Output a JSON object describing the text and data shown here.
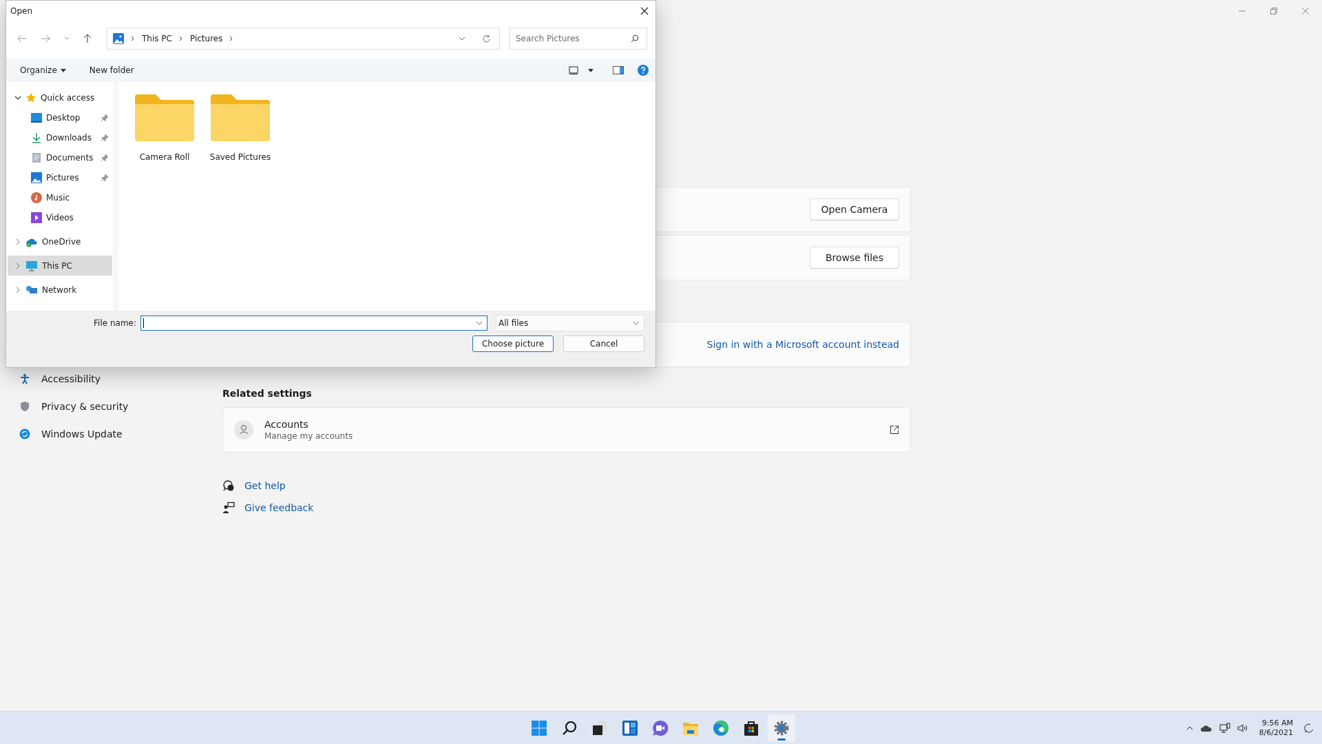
{
  "settings": {
    "sidebar": [
      {
        "label": "Accessibility",
        "kind": "accessibility"
      },
      {
        "label": "Privacy & security",
        "kind": "privacy"
      },
      {
        "label": "Windows Update",
        "kind": "update"
      }
    ],
    "cards": [
      {
        "kind": "button",
        "label": "Open Camera"
      },
      {
        "kind": "button",
        "label": "Browse files"
      },
      {
        "kind": "link",
        "label": "Sign in with a Microsoft account instead"
      }
    ],
    "related_heading": "Related settings",
    "related": [
      {
        "title": "Accounts",
        "subtitle": "Manage my accounts"
      }
    ],
    "help_links": [
      {
        "kind": "help",
        "label": "Get help"
      },
      {
        "kind": "feedback",
        "label": "Give feedback"
      }
    ]
  },
  "dialog": {
    "title": "Open",
    "breadcrumb": [
      "This PC",
      "Pictures"
    ],
    "search": {
      "placeholder": "Search Pictures"
    },
    "toolbar": [
      "Organize",
      "New folder"
    ],
    "nav": [
      {
        "label": "Quick access",
        "kind": "star",
        "expanded": true,
        "selected": false,
        "children": [
          {
            "label": "Desktop",
            "kind": "desktop",
            "pinned": true
          },
          {
            "label": "Downloads",
            "kind": "downloads",
            "pinned": true
          },
          {
            "label": "Documents",
            "kind": "documents",
            "pinned": true
          },
          {
            "label": "Pictures",
            "kind": "pictures",
            "pinned": true
          },
          {
            "label": "Music",
            "kind": "music",
            "pinned": false
          },
          {
            "label": "Videos",
            "kind": "videos",
            "pinned": false
          }
        ]
      },
      {
        "label": "OneDrive",
        "kind": "cloud",
        "expanded": false,
        "selected": false
      },
      {
        "label": "This PC",
        "kind": "pc",
        "expanded": false,
        "selected": true
      },
      {
        "label": "Network",
        "kind": "network",
        "expanded": false,
        "selected": false
      }
    ],
    "folders": [
      {
        "name": "Camera Roll"
      },
      {
        "name": "Saved Pictures"
      }
    ],
    "file_name_label": "File name:",
    "file_type": "All files",
    "buttons": [
      {
        "label": "Choose picture",
        "kind": "primary"
      },
      {
        "label": "Cancel",
        "kind": "normal"
      }
    ]
  },
  "taskbar": {
    "apps": [
      {
        "kind": "start",
        "selected": false
      },
      {
        "kind": "search",
        "selected": false
      },
      {
        "kind": "taskview",
        "selected": false
      },
      {
        "kind": "widgets",
        "selected": false
      },
      {
        "kind": "chat",
        "selected": false
      },
      {
        "kind": "explorer",
        "selected": false
      },
      {
        "kind": "edge",
        "selected": false
      },
      {
        "kind": "store",
        "selected": false
      },
      {
        "kind": "settings",
        "selected": true
      }
    ],
    "time": "9:56 AM",
    "date": "8/6/2021"
  }
}
